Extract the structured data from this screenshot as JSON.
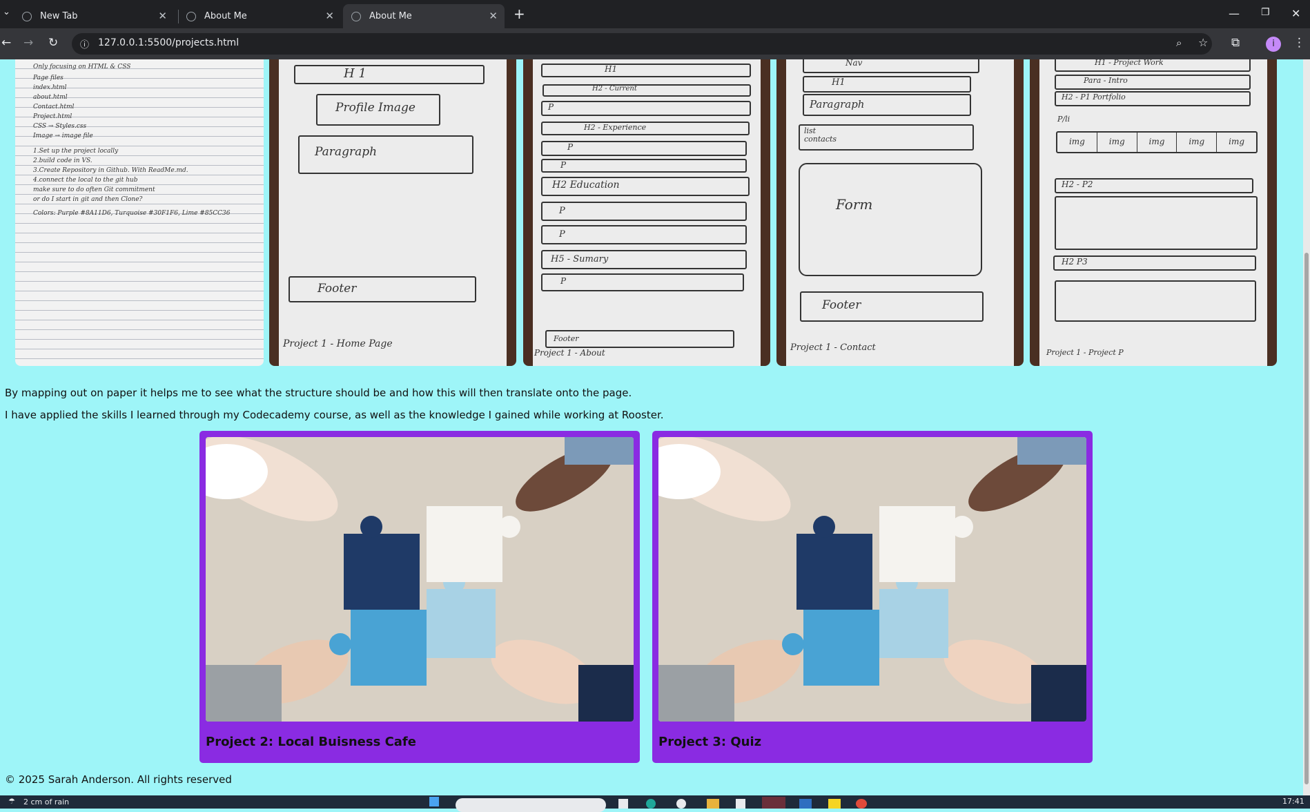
{
  "browser": {
    "tabs": [
      {
        "label": "New Tab"
      },
      {
        "label": "About Me"
      },
      {
        "label": "About Me"
      }
    ],
    "url": "127.0.0.1:5500/projects.html",
    "profile_initial": "i"
  },
  "sketches": {
    "notes": {
      "lines": [
        "Only focusing on HTML & CSS",
        "Page files",
        "index.html",
        "about.html",
        "Contact.html",
        "Project.html",
        "CSS → Styles.css",
        "Image → image file",
        "1.Set up the project locally",
        "2.build code in VS.",
        "3.Create Repository in Github. With ReadMe.md.",
        "4.connect the local to the git hub",
        "make sure to do often Git commitment",
        "or do I start in git and then Clone?",
        "Colors: Purple #8A11D6, Turquoise #30F1F6, Lime #85CC36"
      ]
    },
    "home": {
      "h1": "H 1",
      "img": "Profile Image",
      "para": "Paragraph",
      "footer": "Footer",
      "caption": "Project 1 - Home Page"
    },
    "about": {
      "h1": "H1",
      "h2a": "H2 - Current",
      "p1": "P",
      "h2b": "H2 - Experience",
      "p2": "P",
      "p3": "P",
      "h2c": "H2 Education",
      "p4": "P",
      "p5": "P",
      "h5": "H5 - Sumary",
      "p6": "P",
      "footer": "Footer",
      "caption": "Project 1 - About"
    },
    "contact": {
      "nav": "Nav",
      "h1": "H1",
      "para": "Paragraph",
      "list": "list contacts",
      "form": "Form",
      "footer": "Footer",
      "caption": "Project 1 - Contact"
    },
    "projects": {
      "h1": "H1 - Project Work",
      "para": "Para - Intro",
      "h2": "H2 - P1 Portfolio",
      "pli": "P/li",
      "img": "img",
      "h2b": "H2 - P2",
      "h2c": "H2 P3",
      "caption": "Project 1 - Project P"
    }
  },
  "main": {
    "para1": "By mapping out on paper it helps me to see what the structure should be and how this will then translate onto the page.",
    "para2": "I have applied the skills I learned through my Codecademy course, as well as the knowledge I gained while working at Rooster."
  },
  "projects": [
    {
      "title": "Project 2: Local Buisness Cafe"
    },
    {
      "title": "Project 3: Quiz"
    }
  ],
  "footer": {
    "text": "© 2025 Sarah Anderson. All rights reserved"
  },
  "taskbar": {
    "weather": "2 cm of rain",
    "time": "17:41"
  }
}
